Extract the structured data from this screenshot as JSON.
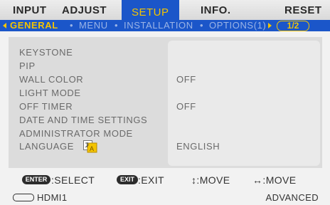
{
  "tabs": [
    {
      "label": "INPUT",
      "active": false
    },
    {
      "label": "ADJUST",
      "active": false
    },
    {
      "label": "SETUP",
      "active": true
    },
    {
      "label": "INFO.",
      "active": false
    },
    {
      "label": "RESET",
      "active": false
    }
  ],
  "subtabs": {
    "general": "GENERAL",
    "menu": "MENU",
    "installation": "INSTALLATION",
    "options": "OPTIONS(1)",
    "page": "1/2",
    "separator": "•"
  },
  "settings": [
    {
      "label": "KEYSTONE",
      "value": ""
    },
    {
      "label": "PIP",
      "value": ""
    },
    {
      "label": "WALL COLOR",
      "value": "OFF"
    },
    {
      "label": "LIGHT MODE",
      "value": ""
    },
    {
      "label": "OFF TIMER",
      "value": "OFF"
    },
    {
      "label": "DATE AND TIME SETTINGS",
      "value": ""
    },
    {
      "label": "ADMINISTRATOR MODE",
      "value": ""
    },
    {
      "label": "LANGUAGE",
      "value": "ENGLISH"
    }
  ],
  "footer": {
    "enter_btn": "ENTER",
    "select": ":SELECT",
    "exit_btn": "EXIT",
    "exit": ":EXIT",
    "move_ud": "↕:MOVE",
    "move_lr": "↔:MOVE",
    "source": "HDMI1",
    "mode": "ADVANCED"
  },
  "colors": {
    "accent_blue": "#1b56c9",
    "highlight_yellow": "#f4c400",
    "panel_gray": "#dcdcdc"
  },
  "icons": [
    "hdmi-connector-icon",
    "language-icon"
  ]
}
